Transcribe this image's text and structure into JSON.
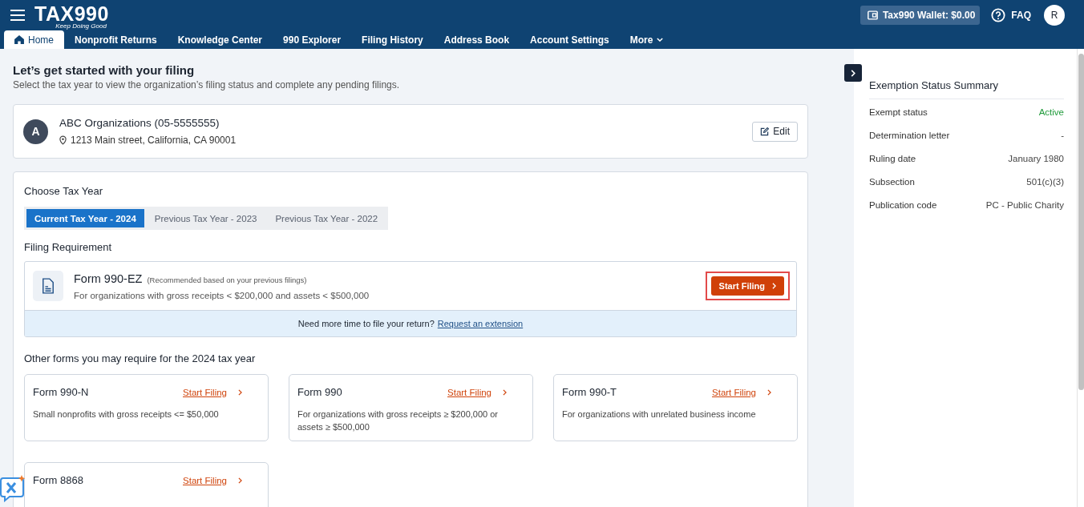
{
  "header": {
    "logo": "TAX990",
    "tagline": "Keep Doing Good",
    "wallet": "Tax990 Wallet: $0.00",
    "faq": "FAQ",
    "avatar": "R"
  },
  "nav": [
    {
      "label": "Home",
      "selected": true,
      "kind": "home"
    },
    {
      "label": "Nonprofit Returns",
      "selected": false
    },
    {
      "label": "Knowledge Center",
      "selected": false
    },
    {
      "label": "990 Explorer",
      "selected": false
    },
    {
      "label": "Filing History",
      "selected": false
    },
    {
      "label": "Address Book",
      "selected": false
    },
    {
      "label": "Account Settings",
      "selected": false
    },
    {
      "label": "More",
      "selected": false,
      "kind": "dropdown"
    }
  ],
  "intro": {
    "title": "Let’s get started with your filing",
    "subtitle": "Select the tax year to view the organization’s filing status and complete any pending filings."
  },
  "organization": {
    "initial": "A",
    "name": "ABC Organizations (05-5555555)",
    "address": "1213 Main street, California, CA 90001",
    "edit": "Edit"
  },
  "tax_year": {
    "heading": "Choose Tax Year",
    "tabs": [
      {
        "label": "Current Tax Year - 2024",
        "selected": true
      },
      {
        "label": "Previous Tax Year - 2023",
        "selected": false
      },
      {
        "label": "Previous Tax Year - 2022",
        "selected": false
      }
    ]
  },
  "requirement": {
    "heading": "Filing Requirement",
    "form": "Form 990-EZ",
    "note": "(Recommended based on your previous filings)",
    "description": "For organizations with gross receipts < $200,000 and assets < $500,000",
    "button": "Start Filing",
    "extension_text": "Need more time to file your return?",
    "extension_link": "Request an extension"
  },
  "other_forms": {
    "heading": "Other forms you may require for the 2024 tax year",
    "forms": [
      {
        "name": "Form 990-N",
        "link": "Start Filing",
        "description": "Small nonprofits with gross receipts <= $50,000"
      },
      {
        "name": "Form 990",
        "link": "Start Filing",
        "description": "For organizations with gross receipts ≥ $200,000 or assets ≥ $500,000"
      },
      {
        "name": "Form 990-T",
        "link": "Start Filing",
        "description": "For organizations with unrelated business income"
      },
      {
        "name": "Form 8868",
        "link": "Start Filing"
      }
    ]
  },
  "summary": {
    "title": "Exemption Status Summary",
    "rows": [
      {
        "label": "Exempt status",
        "value": "Active",
        "kind": "status"
      },
      {
        "label": "Determination letter",
        "value": "-"
      },
      {
        "label": "Ruling date",
        "value": "January 1980"
      },
      {
        "label": "Subsection",
        "value": "501(c)(3)"
      },
      {
        "label": "Publication code",
        "value": "PC - Public Charity"
      }
    ]
  }
}
